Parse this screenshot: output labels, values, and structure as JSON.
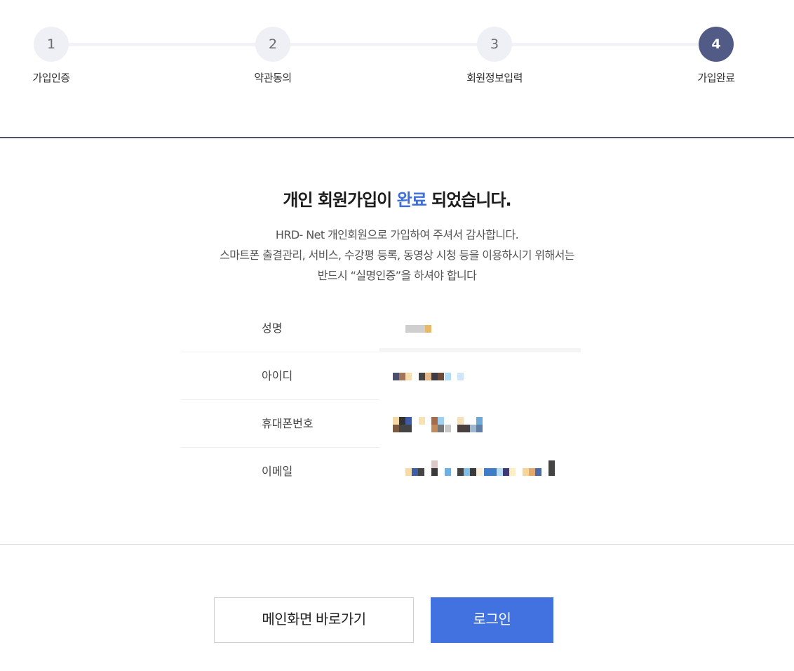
{
  "steps": [
    {
      "number": "1",
      "label": "가입인증",
      "active": false
    },
    {
      "number": "2",
      "label": "약관동의",
      "active": false
    },
    {
      "number": "3",
      "label": "회원정보입력",
      "active": false
    },
    {
      "number": "4",
      "label": "가입완료",
      "active": true
    }
  ],
  "message": {
    "title_before": "개인 회원가입이 ",
    "title_highlight": "완료",
    "title_after": " 되었습니다.",
    "line1": "HRD- Net 개인회원으로 가입하여 주셔서 감사합니다.",
    "line2": "스마트폰 출결관리, 서비스, 수강평 등록, 동영상 시청 등을 이용하시기 위해서는",
    "line3": "반드시 “실명인증”을 하셔야 합니다"
  },
  "info": {
    "name_label": "성명",
    "id_label": "아이디",
    "phone_label": "휴대폰번호",
    "email_label": "이메일"
  },
  "buttons": {
    "main_label": "메인화면 바로가기",
    "login_label": "로그인"
  },
  "colors": {
    "accent": "#3d6fdb",
    "active_step": "#515b85",
    "login_button": "#4172e0"
  }
}
